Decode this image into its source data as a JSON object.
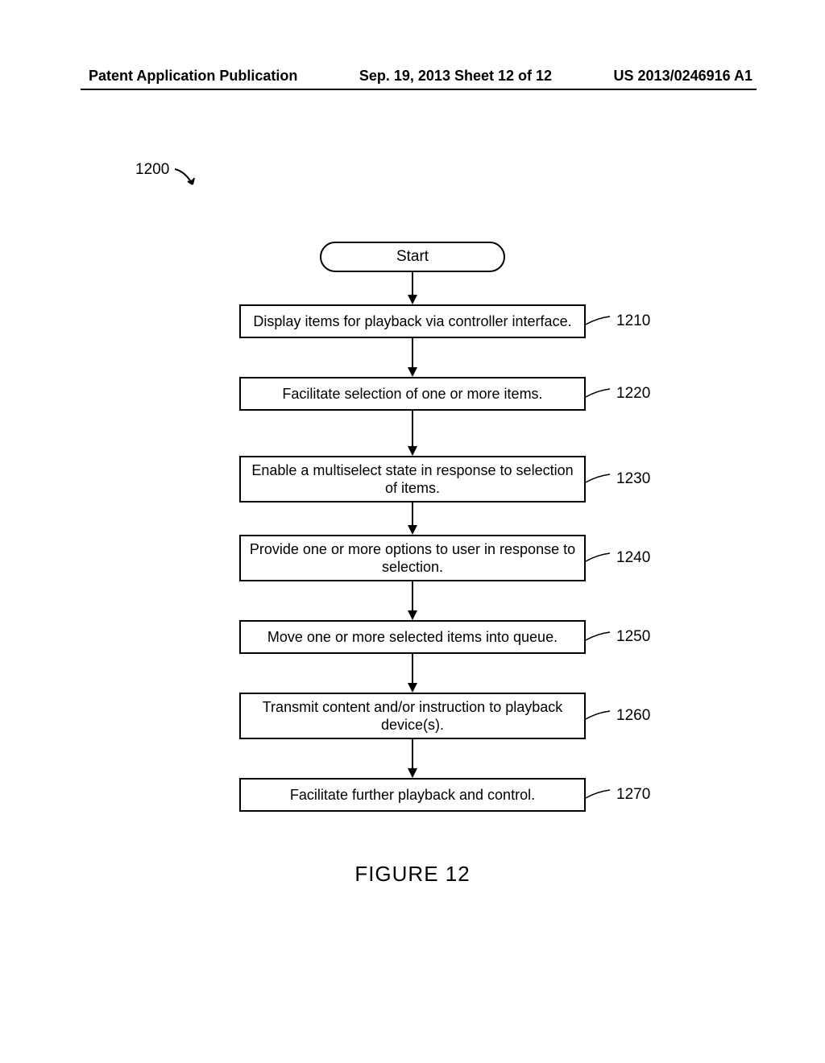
{
  "header": {
    "left": "Patent Application Publication",
    "center": "Sep. 19, 2013  Sheet 12 of 12",
    "right": "US 2013/0246916 A1"
  },
  "diagram": {
    "ref": "1200",
    "start": "Start",
    "steps": [
      {
        "text": "Display items for playback via controller interface.",
        "ref": "1210"
      },
      {
        "text": "Facilitate selection of one or more items.",
        "ref": "1220"
      },
      {
        "text": "Enable a multiselect state in response to selection of items.",
        "ref": "1230"
      },
      {
        "text": "Provide one or more options to user in response to selection.",
        "ref": "1240"
      },
      {
        "text": "Move one or more selected items into queue.",
        "ref": "1250"
      },
      {
        "text": "Transmit content and/or instruction to playback device(s).",
        "ref": "1260"
      },
      {
        "text": "Facilitate further playback and control.",
        "ref": "1270"
      }
    ],
    "caption": "FIGURE 12"
  }
}
